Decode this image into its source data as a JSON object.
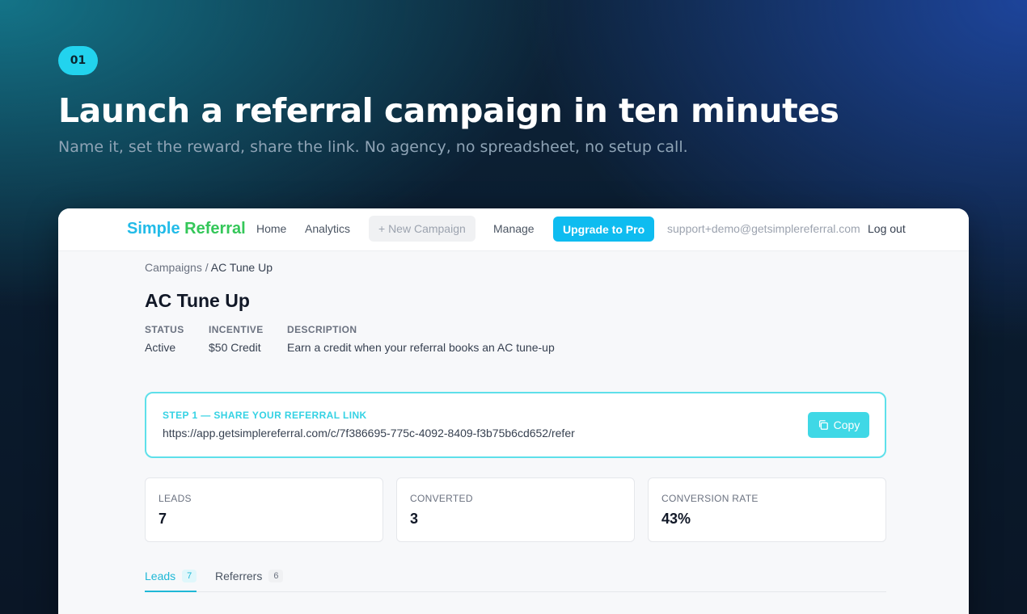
{
  "hero": {
    "step": "01",
    "title": "Launch a referral campaign in ten minutes",
    "subtitle": "Name it, set the reward, share the link. No agency, no spreadsheet, no setup call."
  },
  "nav": {
    "logo_word1": "Simple",
    "logo_word2": "Referral",
    "home": "Home",
    "analytics": "Analytics",
    "new_campaign": "+ New Campaign",
    "manage": "Manage",
    "upgrade": "Upgrade to Pro",
    "email": "support+demo@getsimplereferral.com",
    "logout": "Log out"
  },
  "breadcrumb": {
    "parent": "Campaigns",
    "separator": " / ",
    "current": "AC Tune Up"
  },
  "campaign": {
    "title": "AC Tune Up",
    "status_label": "STATUS",
    "status_value": "Active",
    "incentive_label": "INCENTIVE",
    "incentive_value": "$50 Credit",
    "description_label": "DESCRIPTION",
    "description_value": "Earn a credit when your referral books an AC tune-up"
  },
  "share": {
    "label": "STEP 1 — SHARE YOUR REFERRAL LINK",
    "url": "https://app.getsimplereferral.com/c/7f386695-775c-4092-8409-f3b75b6cd652/refer",
    "copy_label": "Copy",
    "copy_icon": "copy-icon"
  },
  "stats": [
    {
      "label": "LEADS",
      "value": "7"
    },
    {
      "label": "CONVERTED",
      "value": "3"
    },
    {
      "label": "CONVERSION RATE",
      "value": "43%"
    }
  ],
  "tabs": [
    {
      "label": "Leads",
      "count": "7"
    },
    {
      "label": "Referrers",
      "count": "6"
    }
  ],
  "colors": {
    "accent": "#22d3ee",
    "upgrade_button": "#0ebcf0",
    "logo_blue": "#22bbe8",
    "logo_green": "#34c759"
  }
}
